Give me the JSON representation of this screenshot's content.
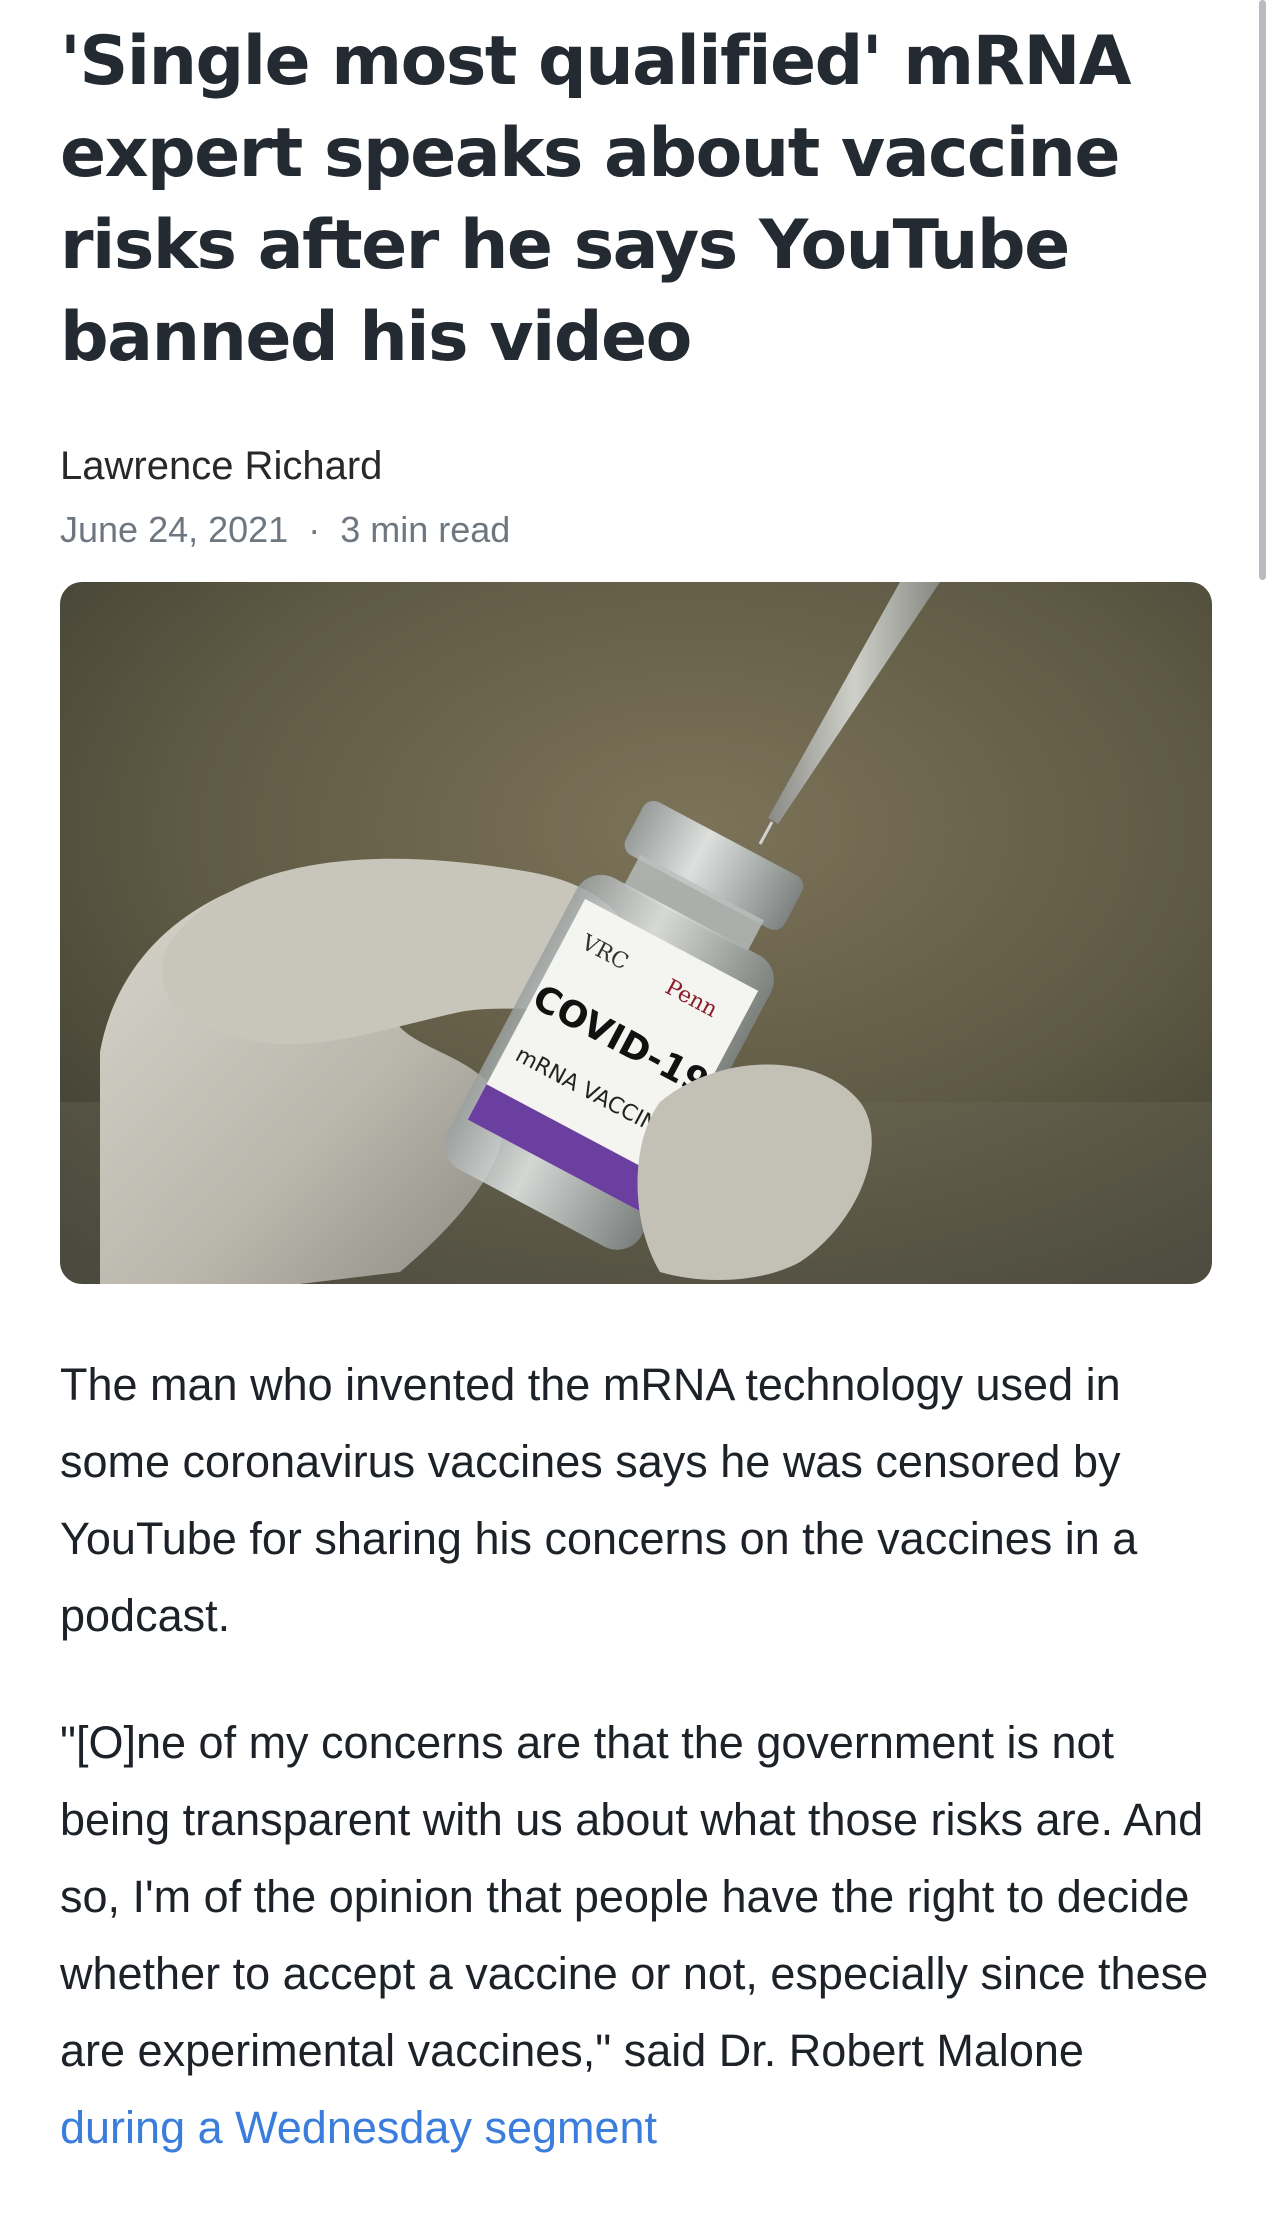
{
  "article": {
    "headline": "'Single most qualified' mRNA expert speaks about vaccine risks after he says YouTube banned his video",
    "author": "Lawrence Richard",
    "date": "June 24, 2021",
    "separator": "·",
    "read_time": "3 min read"
  },
  "hero_image": {
    "vial_label": {
      "org_left": "VRC",
      "org_right": "Penn",
      "product": "COVID-19",
      "subtitle": "mRNA VACCINE"
    }
  },
  "paragraphs": [
    {
      "text": "The man who invented the mRNA technology used in some coronavirus vaccines says he was censored by YouTube for sharing his concerns on the vaccines in a podcast."
    },
    {
      "text": "\"[O]ne of my concerns are that the government is not being transparent with us about what those risks are. And so, I'm of the opinion that people have the right to decide whether to accept a vaccine or not, especially since these are experimental vaccines,\" said Dr. Robert Malone ",
      "link_text": "during a Wednesday segment"
    }
  ],
  "colors": {
    "headline": "#232a31",
    "meta": "#6e7780",
    "link": "#3b7ddd"
  }
}
